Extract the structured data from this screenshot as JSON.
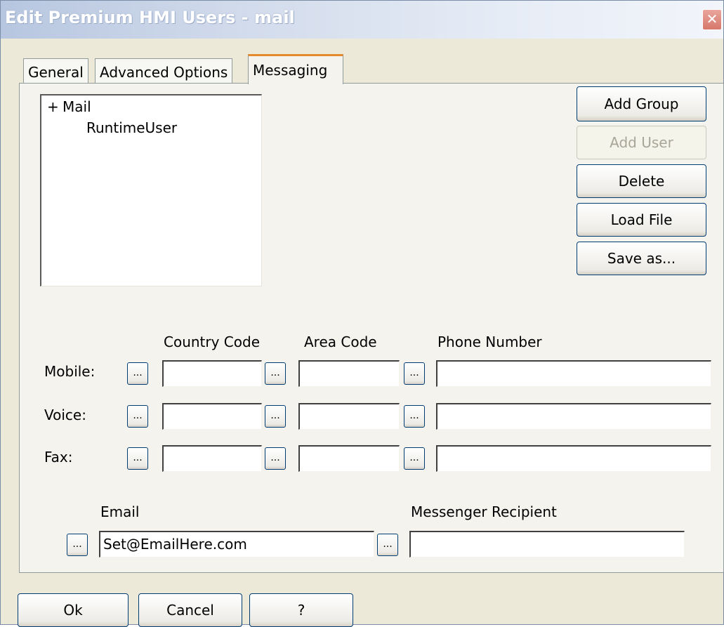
{
  "window": {
    "title": "Edit Premium HMI Users - mail",
    "close_symbol": "✕"
  },
  "tabs": [
    {
      "label": "General",
      "active": false
    },
    {
      "label": "Advanced Options",
      "active": false
    },
    {
      "label": "Messaging",
      "active": true
    }
  ],
  "tree": {
    "group": {
      "expander": "+",
      "label": "Mail"
    },
    "user": {
      "label": "RuntimeUser"
    }
  },
  "actions": {
    "add_group": "Add Group",
    "add_user": "Add User",
    "delete": "Delete",
    "load_file": "Load File",
    "save_as": "Save as..."
  },
  "phone": {
    "headers": {
      "country_code": "Country Code",
      "area_code": "Area Code",
      "phone_number": "Phone Number"
    },
    "rows": [
      {
        "label": "Mobile:",
        "country_code": "",
        "area_code": "",
        "phone_number": ""
      },
      {
        "label": "Voice:",
        "country_code": "",
        "area_code": "",
        "phone_number": ""
      },
      {
        "label": "Fax:",
        "country_code": "",
        "area_code": "",
        "phone_number": ""
      }
    ],
    "browse_label": "..."
  },
  "email": {
    "label": "Email",
    "value": "Set@EmailHere.com"
  },
  "messenger": {
    "label": "Messenger Recipient",
    "value": ""
  },
  "footer": {
    "ok": "Ok",
    "cancel": "Cancel",
    "help": "?"
  }
}
